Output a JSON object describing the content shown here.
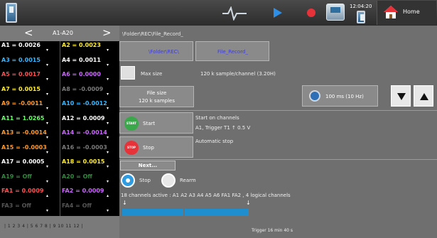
{
  "topbar": {
    "time": "12:04:20",
    "home_label": "Home"
  },
  "channels_nav": {
    "label": "A1-A20",
    "prev": "<",
    "next": ">"
  },
  "channels": [
    {
      "left": "A1 = 0.0026",
      "left_color": "#ffffff",
      "right": "A2 = 0.0023",
      "right_color": "#ffee33"
    },
    {
      "left": "A3 = 0.0015",
      "left_color": "#38b8ff",
      "right": "A4 = 0.0011",
      "right_color": "#ffffff"
    },
    {
      "left": "A5 = 0.0017",
      "left_color": "#ff5050",
      "right": "A6 = 0.0000",
      "right_color": "#cc66ff"
    },
    {
      "left": "A7 = 0.0015",
      "left_color": "#ffee33",
      "right": "A8 = -0.0009",
      "right_color": "#7a7a7a"
    },
    {
      "left": "A9 = -0.0011",
      "left_color": "#ff9a2a",
      "right": "A10 = -0.0012",
      "right_color": "#38b8ff"
    },
    {
      "left": "A11 = 1.0265",
      "left_color": "#66ff66",
      "right": "A12 = 0.0009",
      "right_color": "#ffffff"
    },
    {
      "left": "A13 = -0.0014",
      "left_color": "#ff9a2a",
      "right": "A14 = -0.0014",
      "right_color": "#cc66ff"
    },
    {
      "left": "A15 = -0.0003",
      "left_color": "#ff9a2a",
      "right": "A16 = -0.0003",
      "right_color": "#7a7a7a"
    },
    {
      "left": "A17 = 0.0005",
      "left_color": "#ffffff",
      "right": "A18 = 0.0015",
      "right_color": "#ffee33"
    },
    {
      "left": "A19 = Off",
      "left_color": "#2e8a3a",
      "right": "A20 = Off",
      "right_color": "#2e8a3a"
    },
    {
      "left": "FA1 = 0.0009",
      "left_color": "#ff5050",
      "right": "FA2 = 0.0009",
      "right_color": "#cc66ff"
    },
    {
      "left": "FA3 = Off",
      "left_color": "#555555",
      "right": "FA4 = Off",
      "right_color": "#555555"
    }
  ],
  "page_numbers": "| 1  2  3  4 | 5  6  7  8 | 9  10  11  12 |",
  "record": {
    "path": "\\Folder\\REC\\File_Record_",
    "folder_button": "\\Folder\\REC\\",
    "file_button": "File_Record_",
    "max_size_label": "Max size",
    "samples_per_channel": "120 k sample/channel  (3.20H)",
    "file_size_title": "File size",
    "file_size_value": "120 k samples",
    "sample_rate": "100 ms  (10 Hz)",
    "start_badge": "START",
    "start_label": "Start",
    "start_info_line1": "Start on channels",
    "start_info_line2": "A1, Trigger T1 ↑ 0.5 V",
    "stop_badge": "STOP",
    "stop_label": "Stop",
    "stop_info": "Automatic stop",
    "next_button": "Next...",
    "radio_stop": "Stop",
    "radio_rearm": "Rearm",
    "channels_active": "18 channels active : A1 A2 A3 A4 A5 A6 FA1 FA2 , 4 logical channels",
    "trigger_info": "Trigger 16 min 40 s"
  },
  "colors": {
    "start_badge": "#3aa84a",
    "stop_badge": "#e8323a"
  }
}
